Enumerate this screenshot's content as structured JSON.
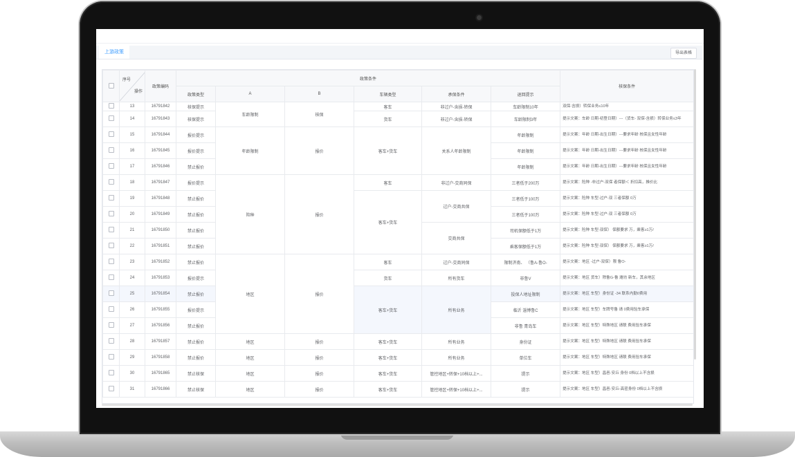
{
  "colors": {
    "accent": "#409eff",
    "bezel": "#111111"
  },
  "tabs": [
    {
      "label": "上游政策"
    }
  ],
  "toolbar": {
    "export_label": "导出表格"
  },
  "table": {
    "header": {
      "select": "",
      "seq": "序号",
      "op": "操作",
      "code": "政策编码",
      "conditions_group": "政策条件",
      "policy_type": "政策类型",
      "a": "A",
      "b": "B",
      "vehicle": "车辆类型",
      "underwrite": "承保条件",
      "return_tip": "退回提示",
      "core": "核保条件"
    },
    "rows": [
      {
        "seq": "13",
        "code": "16791842",
        "type": "核保提示",
        "a": "车龄限制",
        "b": "核保",
        "vehicle": "客车",
        "uw": "非过户-含损-转保",
        "ret": "车龄限制10年",
        "cond": "双保-含损）转保业务≤10年"
      },
      {
        "seq": "14",
        "code": "16791843",
        "type": "核保提示",
        "a": "",
        "b": "",
        "vehicle": "货车",
        "uw": "非过户-含损-转保",
        "ret": "车龄限制3年",
        "cond": "提示文案：车龄 日期-初登日期）---（货车- 双保-含损）转保业务≤3年"
      },
      {
        "seq": "15",
        "code": "16791844",
        "type": "报价提示",
        "a": "年龄限制",
        "b": "报价",
        "vehicle": "客车+货车",
        "uw": "关系人年龄限制",
        "ret": "年龄限制",
        "cond": "提示文案：年龄 日期-出生日期）---要求年龄 核保且女性年龄"
      },
      {
        "seq": "16",
        "code": "16791845",
        "type": "报价提示",
        "a": "",
        "b": "",
        "vehicle": "",
        "uw": "",
        "ret": "年龄限制",
        "cond": "提示文案：年龄 日期-出生日期）---要求年龄 核保且女性年龄"
      },
      {
        "seq": "17",
        "code": "16791846",
        "type": "禁止报价",
        "a": "",
        "b": "",
        "vehicle": "",
        "uw": "",
        "ret": "年龄限制",
        "cond": "提示文案：年龄 日期-出生日期）---要求年龄 核保且女性年龄"
      },
      {
        "seq": "18",
        "code": "16791847",
        "type": "报价提示",
        "a": "险种",
        "b": "报价",
        "vehicle": "客车",
        "uw": "非过户-交商同保",
        "ret": "三者低于200万",
        "cond": "提示文案：险种 -非过户-双保 者保额＜ 折扣高，推价比"
      },
      {
        "seq": "19",
        "code": "16791848",
        "type": "禁止报价",
        "a": "",
        "b": "",
        "vehicle": "客车+货车",
        "uw": "过户-交商共保",
        "ret": "三者低于100万",
        "cond": "提示文案：险种 车型-过户-双 三者保额 0万"
      },
      {
        "seq": "20",
        "code": "16791849",
        "type": "禁止报价",
        "a": "",
        "b": "",
        "vehicle": "",
        "uw": "",
        "ret": "三者低于100万",
        "cond": "提示文案：险种 车型-过户-双 三者保额 0万"
      },
      {
        "seq": "21",
        "code": "16791850",
        "type": "禁止报价",
        "a": "",
        "b": "",
        "vehicle": "",
        "uw": "交商共保",
        "ret": "司机保额低于1万",
        "cond": "提示文案：险种 车型-双保） 保额要求 万，乘客≥1万/"
      },
      {
        "seq": "22",
        "code": "16791851",
        "type": "禁止报价",
        "a": "",
        "b": "",
        "vehicle": "",
        "uw": "",
        "ret": "乘客保额低于1万",
        "cond": "提示文案：险种 车型-双保） 保额要求 万，乘客≥1万/"
      },
      {
        "seq": "23",
        "code": "16791852",
        "type": "禁止报价",
        "a": "地区",
        "b": "报价",
        "vehicle": "客车",
        "uw": "过户-交商同保",
        "ret": "限制济南、 （鲁A-鲁O-",
        "cond": "提示文案：地区 -过户-双保）限 鲁O-"
      },
      {
        "seq": "24",
        "code": "16791853",
        "type": "报价提示",
        "a": "",
        "b": "",
        "vehicle": "货车",
        "uw": "所有货车",
        "ret": "非鲁V",
        "cond": "提示文案：地区 货车）除鲁G-鲁 潍坊 新车，其余地区"
      },
      {
        "seq": "25",
        "code": "16791854",
        "type": "禁止报价",
        "a": "",
        "b": "",
        "vehicle": "客车+货车",
        "uw": "所有业务",
        "ret": "投保人地址限制",
        "cond": "提示文案：地区 车型）身份证 -34 联系内勤0费用"
      },
      {
        "seq": "26",
        "code": "16791855",
        "type": "报价提示",
        "a": "",
        "b": "",
        "vehicle": "",
        "uw": "",
        "ret": "临沂 淄博鲁C",
        "cond": "提示文案：地区 车型）车牌号鲁 请 0费用验车承保"
      },
      {
        "seq": "27",
        "code": "16791856",
        "type": "禁止报价",
        "a": "",
        "b": "",
        "vehicle": "",
        "uw": "",
        "ret": "非鲁 青岛车",
        "cond": "提示文案：地区 车型）特殊地区 请联 费用验车承保"
      },
      {
        "seq": "28",
        "code": "16791857",
        "type": "禁止报价",
        "a": "地区",
        "b": "报价",
        "vehicle": "客车+货车",
        "uw": "所有业务",
        "ret": "身份证",
        "cond": "提示文案：地区 车型）特殊地区 请联 费用验车承保"
      },
      {
        "seq": "29",
        "code": "16791858",
        "type": "禁止报价",
        "a": "地区",
        "b": "报价",
        "vehicle": "客车+货车",
        "uw": "所有业务",
        "ret": "单位车",
        "cond": "提示文案：地区 车型）特殊地区 请联 费用验车承保"
      },
      {
        "seq": "30",
        "code": "16791865",
        "type": "禁止核保",
        "a": "地区",
        "b": "报价",
        "vehicle": "客车+货车",
        "uw": "管控地区+转保+10档以上+...",
        "ret": "提示",
        "cond": "提示文案：地区 车型）昌邑-安丘 身份 0档以上不含损"
      },
      {
        "seq": "31",
        "code": "16791866",
        "type": "禁止核保",
        "a": "地区",
        "b": "报价",
        "vehicle": "客车+货车",
        "uw": "管控地区+转保+10档以上+...",
        "ret": "提示",
        "cond": "提示文案：地区 车型）昌邑-安丘-高密身份 0档以上不含损"
      }
    ]
  }
}
